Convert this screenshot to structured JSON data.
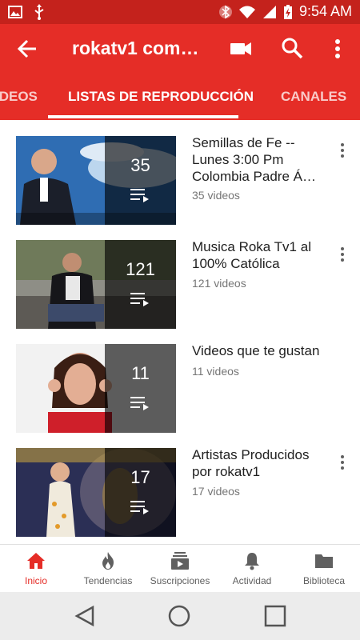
{
  "status_bar": {
    "time": "9:54 AM",
    "icons": [
      "image-icon",
      "usb-icon",
      "bluetooth-icon",
      "wifi-icon",
      "signal-icon",
      "battery-icon"
    ]
  },
  "app_bar": {
    "title": "rokatv1 com…",
    "icons": [
      "back-arrow-icon",
      "camera-icon",
      "search-icon",
      "more-vert-icon"
    ]
  },
  "tabs": [
    {
      "label": "IDEOS"
    },
    {
      "label": "LISTAS DE REPRODUCCIÓN"
    },
    {
      "label": "CANALES"
    }
  ],
  "playlists": [
    {
      "title": "Semillas de Fe -- Lunes 3:00 Pm Colombia  Padre Á…",
      "count": "35",
      "subtitle": "35 videos"
    },
    {
      "title": "Musica  Roka Tv1 al 100% Católica",
      "count": "121",
      "subtitle": "121 videos"
    },
    {
      "title": "Videos que te gustan",
      "count": "11",
      "subtitle": "11 videos"
    },
    {
      "title": "Artistas Producidos por rokatv1",
      "count": "17",
      "subtitle": "17 videos"
    }
  ],
  "bottom_nav": [
    {
      "label": "Inicio",
      "icon": "home-icon"
    },
    {
      "label": "Tendencias",
      "icon": "flame-icon"
    },
    {
      "label": "Suscripciones",
      "icon": "subscriptions-icon"
    },
    {
      "label": "Actividad",
      "icon": "bell-icon"
    },
    {
      "label": "Biblioteca",
      "icon": "folder-icon"
    }
  ],
  "colors": {
    "brand": "#e52d27",
    "status_bar": "#c4221c",
    "active_nav": "#e52d27"
  }
}
